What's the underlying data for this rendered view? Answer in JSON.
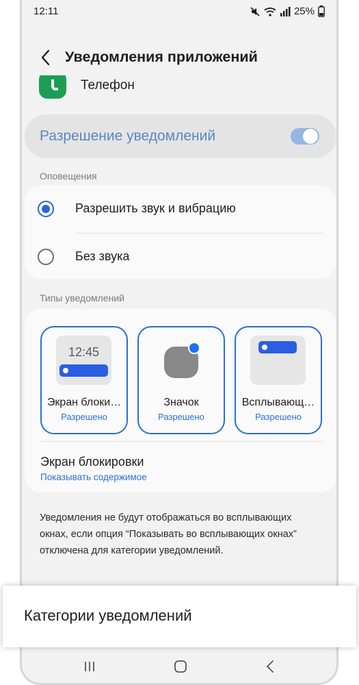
{
  "status_bar": {
    "time": "12:11",
    "battery": "25%",
    "icons": [
      "mute-icon",
      "wifi-icon",
      "signal-icon",
      "battery-icon"
    ]
  },
  "header": {
    "title": "Уведомления приложений",
    "back_icon": "chevron-left-icon"
  },
  "app": {
    "name": "Телефон",
    "icon": "phone-app-icon"
  },
  "permission": {
    "label": "Разрешение уведомлений",
    "enabled": true
  },
  "alerts": {
    "section_label": "Оповещения",
    "options": [
      {
        "label": "Разрешить звук и вибрацию",
        "selected": true
      },
      {
        "label": "Без звука",
        "selected": false
      }
    ]
  },
  "types": {
    "section_label": "Типы уведомлений",
    "tiles": [
      {
        "name": "Экран блоки…",
        "status": "Разрешено",
        "preview_time": "12:45"
      },
      {
        "name": "Значок",
        "status": "Разрешено"
      },
      {
        "name": "Всплывающ…",
        "status": "Разрешено"
      }
    ],
    "lock_screen": {
      "title": "Экран блокировки",
      "value": "Показывать содержимое"
    }
  },
  "note": "Уведомления не будут отображаться во всплывающих окнах, если опция “Показывать во всплывающих окнах” отключена для категории уведомлений.",
  "bottom_sheet": {
    "label": "Категории уведомлений"
  },
  "navbar": {
    "buttons": [
      "recents-icon",
      "home-icon",
      "back-icon"
    ]
  },
  "colors": {
    "accent": "#2a6fd6",
    "toggle_on": "#93b6e3",
    "app_icon": "#1a9e53"
  }
}
